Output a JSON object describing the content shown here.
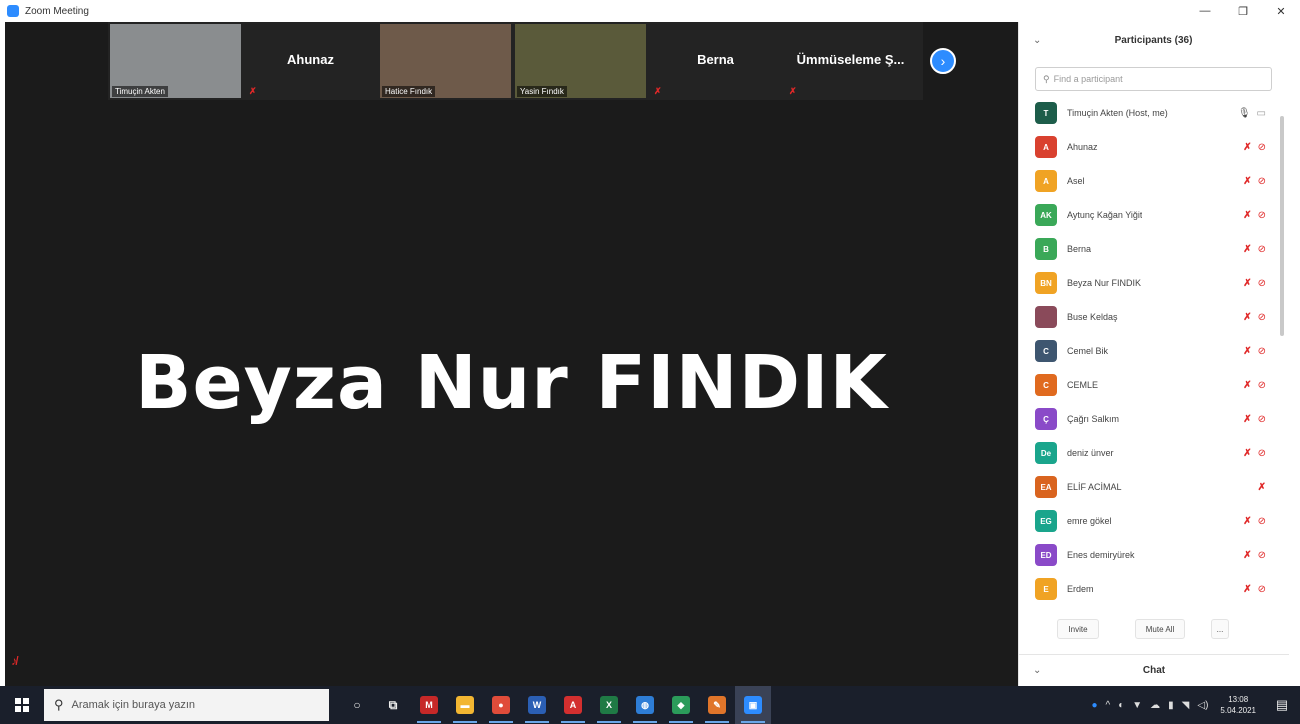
{
  "window": {
    "title": "Zoom Meeting",
    "minimize": "—",
    "maximize": "❐",
    "close": "✕"
  },
  "gallery": {
    "tiles": [
      {
        "name": "Timuçin Akten",
        "type": "video",
        "color": "#8a8d8f"
      },
      {
        "name": "Ahunaz",
        "type": "name"
      },
      {
        "name": "Hatice Fındık",
        "type": "video",
        "color": "#6e5a4a"
      },
      {
        "name": "Yasin Fındık",
        "type": "video",
        "color": "#5a5a3a"
      },
      {
        "name": "Berna",
        "type": "name"
      },
      {
        "name": "Ümmüseleme Ş...",
        "type": "name"
      }
    ],
    "next_icon": "›"
  },
  "active_speaker": {
    "name": "Beyza Nur FINDIK"
  },
  "participants_panel": {
    "title": "Participants (36)",
    "search_placeholder": "Find a participant",
    "participants": [
      {
        "initials": "T",
        "name": "Timuçin Akten (Host, me)",
        "color": "#1d5d4a",
        "mic": "on",
        "cam": "on"
      },
      {
        "initials": "A",
        "name": "Ahunaz",
        "color": "#d9412f",
        "mic": "off",
        "cam": "off"
      },
      {
        "initials": "A",
        "name": "Asel",
        "color": "#f0a324",
        "mic": "off",
        "cam": "off"
      },
      {
        "initials": "AK",
        "name": "Aytunç Kağan Yiğit",
        "color": "#3aa858",
        "mic": "off",
        "cam": "off"
      },
      {
        "initials": "B",
        "name": "Berna",
        "color": "#3aa858",
        "mic": "off",
        "cam": "off"
      },
      {
        "initials": "BN",
        "name": "Beyza Nur FINDIK",
        "color": "#f0a324",
        "mic": "off",
        "cam": "off"
      },
      {
        "initials": "",
        "name": "Buse Keldaş",
        "color": "#8a4a5a",
        "mic": "off",
        "cam": "off"
      },
      {
        "initials": "C",
        "name": "Cemel Bik",
        "color": "#3e5670",
        "mic": "off",
        "cam": "off"
      },
      {
        "initials": "C",
        "name": "CEMLE",
        "color": "#e06a1f",
        "mic": "off",
        "cam": "off"
      },
      {
        "initials": "Ç",
        "name": "Çağrı Salkım",
        "color": "#8a4ac8",
        "mic": "off",
        "cam": "off"
      },
      {
        "initials": "De",
        "name": "deniz ünver",
        "color": "#1aa58c",
        "mic": "off",
        "cam": "off"
      },
      {
        "initials": "EA",
        "name": "ELİF ACİMAL",
        "color": "#d9641f",
        "mic": "off",
        "cam": "none"
      },
      {
        "initials": "EG",
        "name": "emre gökel",
        "color": "#1aa58c",
        "mic": "off",
        "cam": "off"
      },
      {
        "initials": "ED",
        "name": "Enes demiryürek",
        "color": "#8a4ac8",
        "mic": "off",
        "cam": "off"
      },
      {
        "initials": "E",
        "name": "Erdem",
        "color": "#f0a324",
        "mic": "off",
        "cam": "off"
      }
    ],
    "invite_label": "Invite",
    "mute_all_label": "Mute All",
    "more_label": "...",
    "chat_label": "Chat"
  },
  "taskbar": {
    "search_placeholder": "Aramak için buraya yazın",
    "apps": [
      {
        "name": "cortana",
        "glyph": "○",
        "color": "transparent"
      },
      {
        "name": "task-view",
        "glyph": "⧉",
        "color": "transparent"
      },
      {
        "name": "app-m",
        "glyph": "M",
        "color": "#c62828"
      },
      {
        "name": "file-explorer",
        "glyph": "▬",
        "color": "#f2b632"
      },
      {
        "name": "chrome",
        "glyph": "●",
        "color": "#e04c3a"
      },
      {
        "name": "word",
        "glyph": "W",
        "color": "#2b5fb4"
      },
      {
        "name": "acrobat",
        "glyph": "A",
        "color": "#d32f2f"
      },
      {
        "name": "excel",
        "glyph": "X",
        "color": "#1f7a45"
      },
      {
        "name": "globe",
        "glyph": "◍",
        "color": "#2e7dd6"
      },
      {
        "name": "store",
        "glyph": "◆",
        "color": "#2b9b5a"
      },
      {
        "name": "paint",
        "glyph": "✎",
        "color": "#e0752a"
      },
      {
        "name": "zoom",
        "glyph": "▣",
        "color": "#2d8cff"
      }
    ],
    "clock_time": "13:08",
    "clock_date": "5.04.2021"
  }
}
